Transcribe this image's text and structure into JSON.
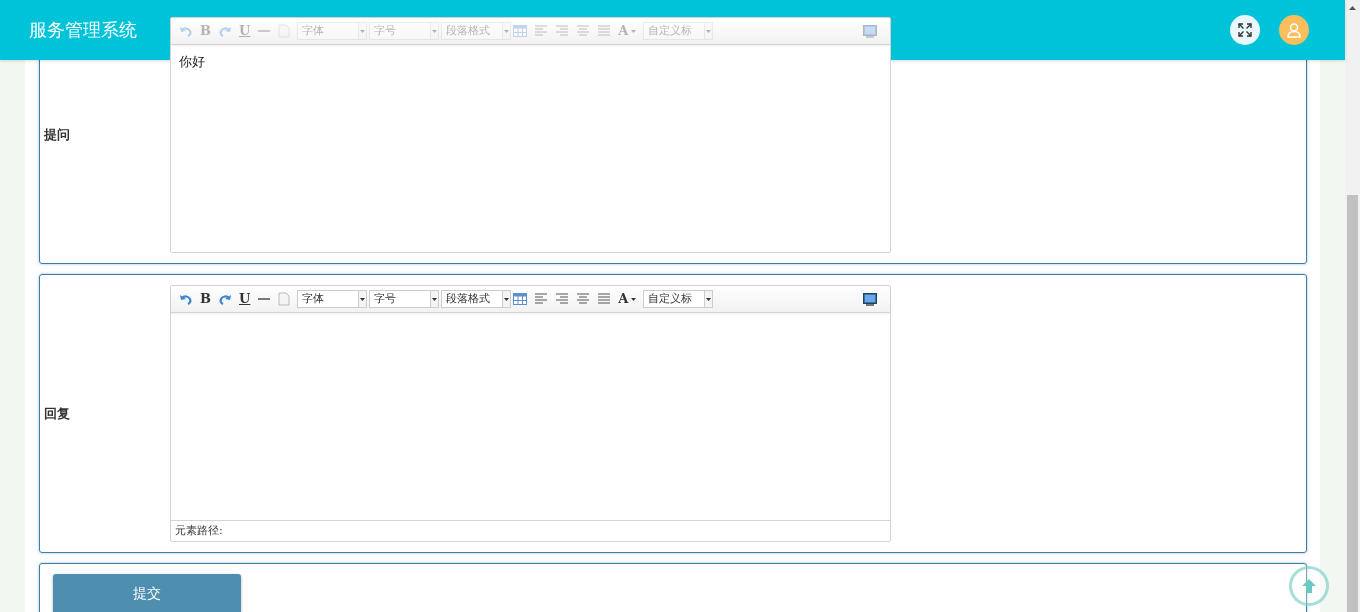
{
  "header": {
    "title": "服务管理系统"
  },
  "editors": [
    {
      "label": "提问",
      "toolbar": {
        "disabled": true,
        "items": [
          {
            "kind": "undo"
          },
          {
            "kind": "glyph",
            "text": "B"
          },
          {
            "kind": "redo"
          },
          {
            "kind": "underline",
            "text": "U"
          },
          {
            "kind": "rule"
          },
          {
            "kind": "page"
          },
          {
            "kind": "dropdown",
            "text": "字体"
          },
          {
            "kind": "dropdown",
            "text": "字号"
          },
          {
            "kind": "dropdown",
            "text": "段落格式"
          },
          {
            "kind": "table"
          },
          {
            "kind": "align-left"
          },
          {
            "kind": "align-right"
          },
          {
            "kind": "align-center"
          },
          {
            "kind": "align-justify"
          },
          {
            "kind": "color",
            "text": "A"
          },
          {
            "kind": "dropdown",
            "text": "自定义标"
          }
        ]
      },
      "content": "你好"
    },
    {
      "label": "回复",
      "toolbar": {
        "disabled": false,
        "items": [
          {
            "kind": "undo"
          },
          {
            "kind": "glyph",
            "text": "B"
          },
          {
            "kind": "redo"
          },
          {
            "kind": "underline",
            "text": "U"
          },
          {
            "kind": "rule"
          },
          {
            "kind": "page"
          },
          {
            "kind": "dropdown",
            "text": "字体"
          },
          {
            "kind": "dropdown",
            "text": "字号"
          },
          {
            "kind": "dropdown",
            "text": "段落格式"
          },
          {
            "kind": "table"
          },
          {
            "kind": "align-left"
          },
          {
            "kind": "align-right"
          },
          {
            "kind": "align-center"
          },
          {
            "kind": "align-justify"
          },
          {
            "kind": "color",
            "text": "A"
          },
          {
            "kind": "dropdown",
            "text": "自定义标"
          }
        ]
      },
      "element_path": "元素路径:"
    }
  ],
  "submit": {
    "label": "提交"
  }
}
